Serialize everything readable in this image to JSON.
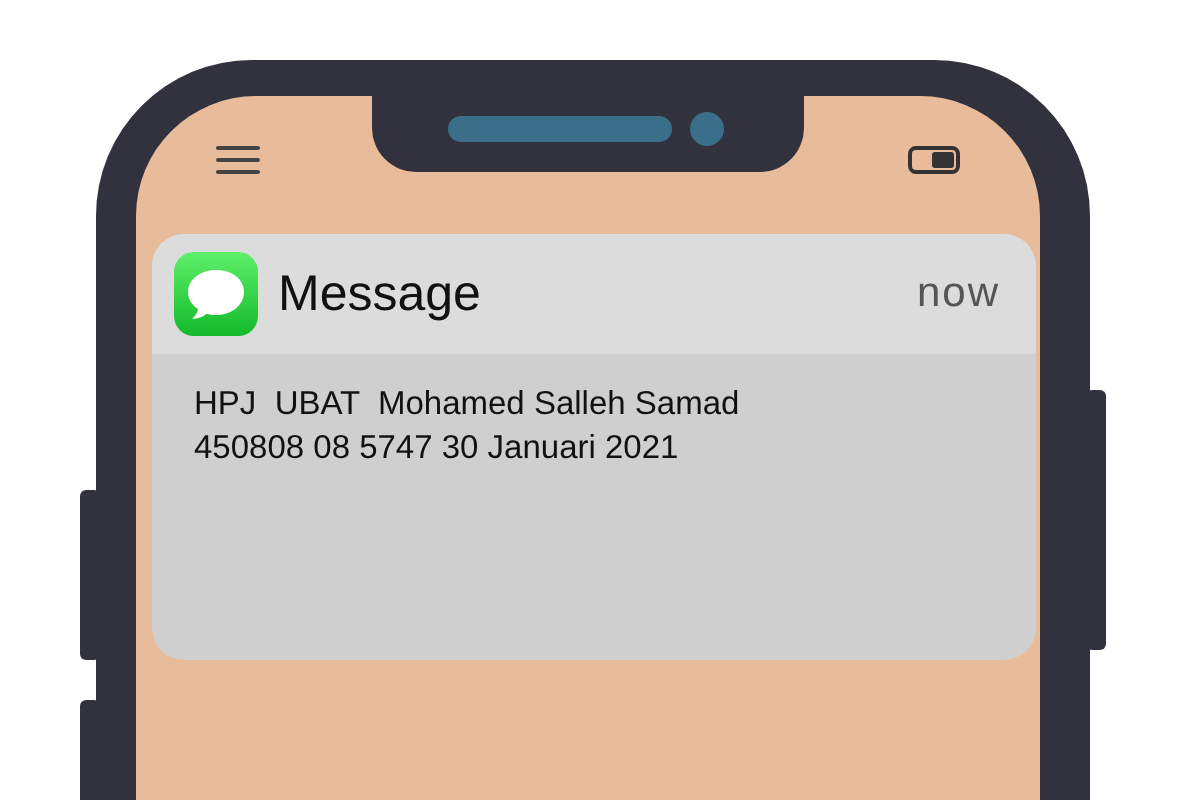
{
  "notification": {
    "app": "Message",
    "time": "now",
    "body_lines": [
      "HPJ  UBAT  Mohamed Salleh Samad",
      "450808 08 5747 30 Januari 2021"
    ]
  }
}
